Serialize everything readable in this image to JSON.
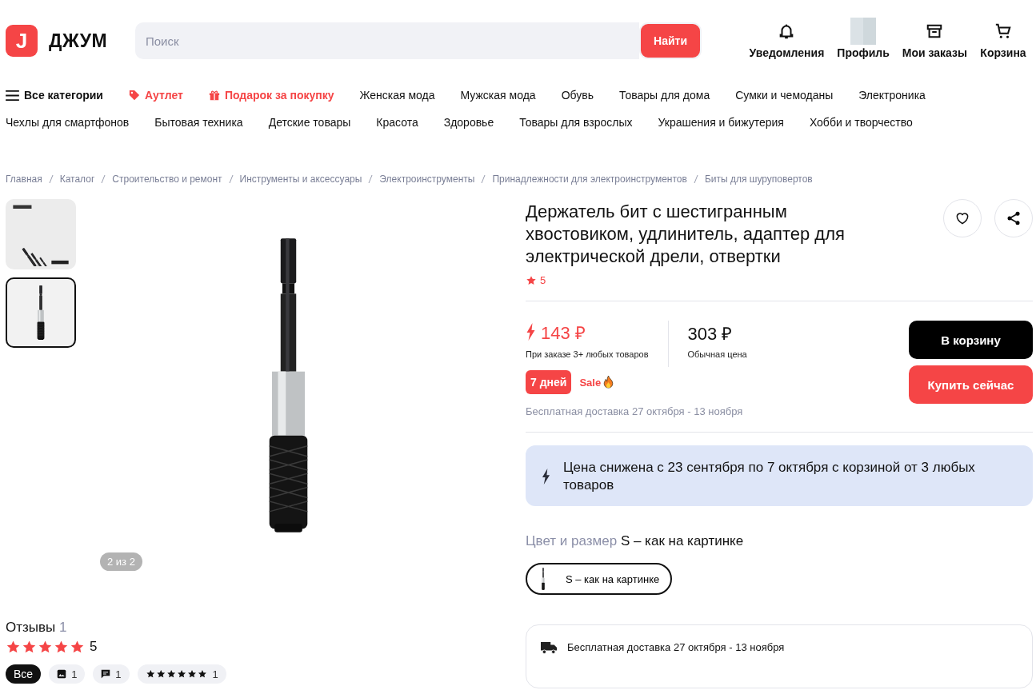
{
  "header": {
    "logo": {
      "mark": "J",
      "text": "ДЖУМ"
    },
    "search": {
      "placeholder": "Поиск",
      "button": "Найти"
    },
    "actions": [
      {
        "kind": "bell",
        "label": "Уведомления"
      },
      {
        "kind": "avatar",
        "label": "Профиль"
      },
      {
        "kind": "box",
        "label": "Мои заказы"
      },
      {
        "kind": "cart",
        "label": "Корзина"
      }
    ]
  },
  "nav": {
    "rows": [
      [
        {
          "kind": "menu",
          "label": "Все категории"
        },
        {
          "kind": "tag",
          "label": "Аутлет"
        },
        {
          "kind": "gift",
          "label": "Подарок за покупку"
        },
        {
          "kind": "plain",
          "label": "Женская мода"
        },
        {
          "kind": "plain",
          "label": "Мужская мода"
        },
        {
          "kind": "plain",
          "label": "Обувь"
        },
        {
          "kind": "plain",
          "label": "Товары для дома"
        },
        {
          "kind": "plain",
          "label": "Сумки и чемоданы"
        },
        {
          "kind": "plain",
          "label": "Электроника"
        }
      ],
      [
        {
          "kind": "plain",
          "label": "Чехлы для смартфонов"
        },
        {
          "kind": "plain",
          "label": "Бытовая техника"
        },
        {
          "kind": "plain",
          "label": "Детские товары"
        },
        {
          "kind": "plain",
          "label": "Красота"
        },
        {
          "kind": "plain",
          "label": "Здоровье"
        },
        {
          "kind": "plain",
          "label": "Товары для взрослых"
        },
        {
          "kind": "plain",
          "label": "Украшения и бижутерия"
        },
        {
          "kind": "plain",
          "label": "Хобби и творчество"
        }
      ]
    ]
  },
  "breadcrumbs": [
    "Главная",
    "Каталог",
    "Строительство и ремонт",
    "Инструменты и аксессуары",
    "Электроинструменты",
    "Принадлежности для электроинструментов",
    "Биты для шуруповертов"
  ],
  "gallery": {
    "thumbnails": [
      {
        "kind": "set",
        "selected": false
      },
      {
        "kind": "single",
        "selected": true
      }
    ],
    "counter": "2 из 2"
  },
  "product": {
    "title": "Держатель бит с шестигранным хвостовиком, удлинитель, адаптер для электрической дрели, отвертки",
    "rating": "5",
    "price": {
      "sale": "143 ₽",
      "sale_note": "При заказе 3+ любых товаров",
      "regular": "303 ₽",
      "regular_note": "Обычная цена"
    },
    "badges": {
      "days": "7 дней",
      "sale": "Sale"
    },
    "delivery": "Бесплатная доставка 27 октября - 13 ноября",
    "buttons": [
      {
        "kind": "dark",
        "label": "В корзину"
      },
      {
        "kind": "accent",
        "label": "Купить сейчас"
      }
    ],
    "promo": "Цена снижена с 23 сентября по 7 октября с корзиной от 3 любых товаров",
    "variant": {
      "label": "Цвет и размер",
      "value": "S – как на картинке",
      "options": [
        {
          "label": "S – как на картинке",
          "selected": true
        }
      ]
    },
    "delivery_card": "Бесплатная доставка 27 октября - 13 ноября"
  },
  "reviews": {
    "title": "Отзывы",
    "count": "1",
    "stars": 5,
    "score": "5",
    "filters": [
      {
        "kind": "all",
        "label": "Все",
        "selected": true
      },
      {
        "kind": "photo",
        "label": "1",
        "selected": false
      },
      {
        "kind": "comment",
        "label": "1",
        "selected": false
      },
      {
        "kind": "stars",
        "label": "1",
        "selected": false
      }
    ]
  }
}
